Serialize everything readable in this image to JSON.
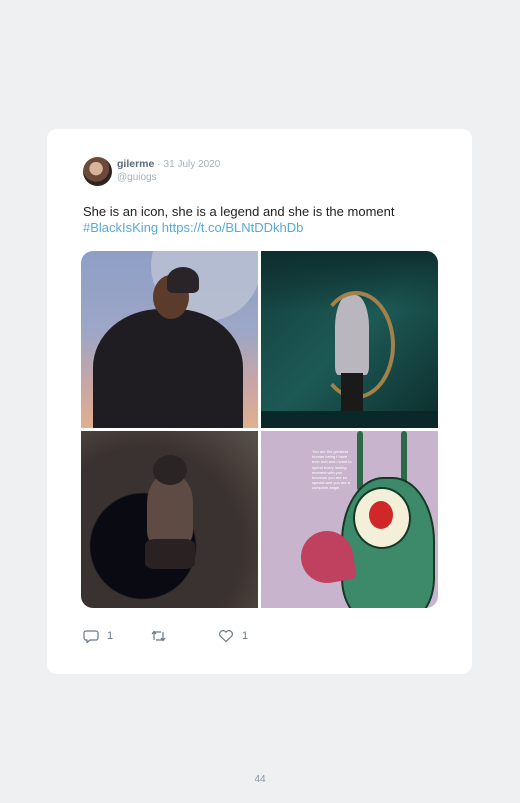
{
  "tweet": {
    "display_name": "gilerme",
    "separator": "·",
    "date": "31 July 2020",
    "handle": "@guiogs",
    "text": "She is an icon, she is a legend and she is the moment",
    "hashtag": "#BlackIsKing",
    "link": "https://t.co/BLNtDDkhDb",
    "meme_text": "You are the greatest human being I have ever met and I want to spend every lasting moment with you because you are so special and you are a complete angel",
    "actions": {
      "reply_count": "1",
      "retweet_count": "",
      "like_count": "1"
    }
  },
  "page_number": "44",
  "colors": {
    "background": "#eef0f2",
    "card": "#ffffff",
    "link": "#57a9d9",
    "muted": "#a6b1bb"
  },
  "icons": [
    "reply-icon",
    "retweet-icon",
    "like-icon"
  ]
}
